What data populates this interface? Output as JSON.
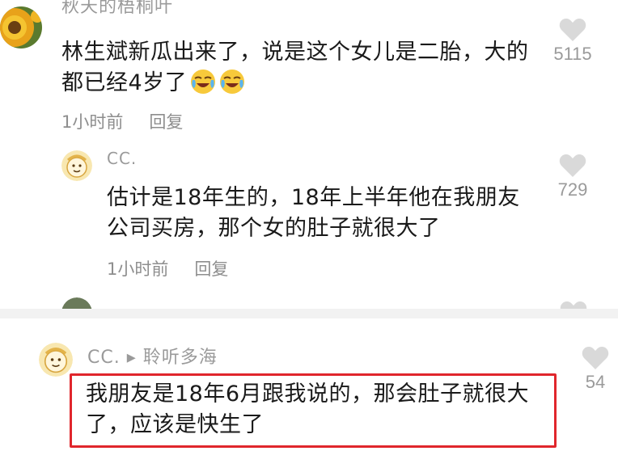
{
  "colors": {
    "highlight": "#e0262c",
    "like_icon": "#d9d9d9",
    "meta_text": "#8e8e8e"
  },
  "comments": [
    {
      "name": "秋天的梧桐叶",
      "text": "林生斌新瓜出来了，说是这个女儿是二胎，大的都已经4岁了",
      "emojis": [
        "laugh-cry-emoji",
        "laugh-cry-emoji"
      ],
      "time": "1小时前",
      "reply": "回复",
      "likes": "5115",
      "avatar": "sunflower-avatar"
    },
    {
      "name": "CC.",
      "text": "估计是18年生的，18年上半年他在我朋友公司买房，那个女的肚子就很大了",
      "time": "1小时前",
      "reply": "回复",
      "likes": "729",
      "avatar": "cartoon-avatar"
    },
    {
      "name": "CC. ▸ 聆听多海",
      "text": "我朋友是18年6月跟我说的，那会肚子就很大了，应该是快生了",
      "likes": "54",
      "avatar": "cartoon-avatar",
      "highlighted": true
    }
  ]
}
